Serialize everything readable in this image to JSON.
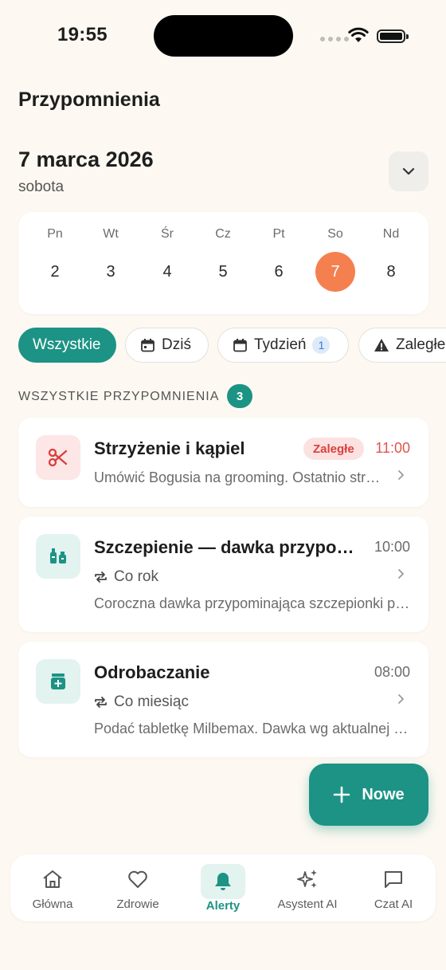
{
  "status_bar": {
    "time": "19:55"
  },
  "header": {
    "title": "Przypomnienia"
  },
  "date": {
    "main": "7 marca 2026",
    "weekday": "sobota"
  },
  "calendar": {
    "days": [
      {
        "dow": "Pn",
        "num": "2"
      },
      {
        "dow": "Wt",
        "num": "3"
      },
      {
        "dow": "Śr",
        "num": "4"
      },
      {
        "dow": "Cz",
        "num": "5"
      },
      {
        "dow": "Pt",
        "num": "6"
      },
      {
        "dow": "So",
        "num": "7"
      },
      {
        "dow": "Nd",
        "num": "8"
      }
    ],
    "selected": "7"
  },
  "filters": {
    "all": "Wszystkie",
    "today": "Dziś",
    "week": "Tydzień",
    "week_count": "1",
    "overdue": "Zaległe"
  },
  "section": {
    "label": "WSZYSTKIE PRZYPOMNIENIA",
    "count": "3"
  },
  "reminders": [
    {
      "title": "Strzyżenie i kąpiel",
      "badge": "Zaległe",
      "time": "11:00",
      "description": "Umówić Bogusia na grooming. Ostatnio strzyżony w styczniu.",
      "icon": "scissors-icon"
    },
    {
      "title": "Szczepienie — dawka przypominająca",
      "time": "10:00",
      "repeat": "Co rok",
      "description": "Coroczna dawka przypominająca szczepionki przeciw wściekliźnie.",
      "icon": "vaccine-icon"
    },
    {
      "title": "Odrobaczanie",
      "time": "08:00",
      "repeat": "Co miesiąc",
      "description": "Podać tabletkę Milbemax. Dawka wg aktualnej wagi.",
      "icon": "medicine-icon"
    }
  ],
  "fab": {
    "label": "Nowe"
  },
  "nav": {
    "home": "Główna",
    "health": "Zdrowie",
    "alerts": "Alerty",
    "assistant": "Asystent AI",
    "chat": "Czat AI"
  },
  "colors": {
    "accent": "#1C9384",
    "selected_day": "#F5804F",
    "overdue": "#E0544C",
    "background": "#FDF9F2"
  }
}
